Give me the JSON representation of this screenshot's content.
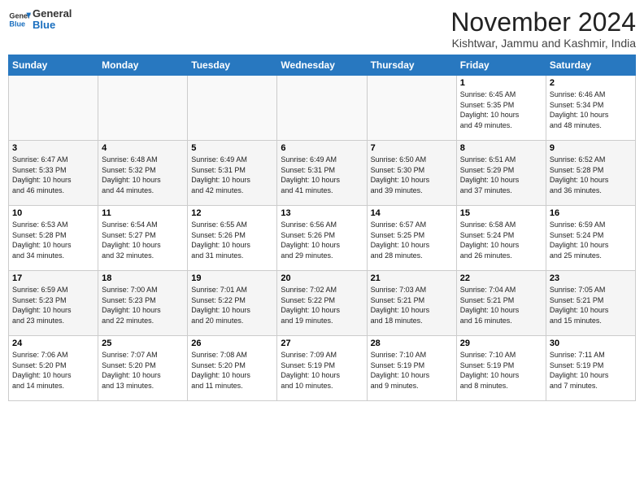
{
  "header": {
    "logo_line1": "General",
    "logo_line2": "Blue",
    "month_title": "November 2024",
    "location": "Kishtwar, Jammu and Kashmir, India"
  },
  "days_of_week": [
    "Sunday",
    "Monday",
    "Tuesday",
    "Wednesday",
    "Thursday",
    "Friday",
    "Saturday"
  ],
  "weeks": [
    [
      {
        "day": "",
        "info": ""
      },
      {
        "day": "",
        "info": ""
      },
      {
        "day": "",
        "info": ""
      },
      {
        "day": "",
        "info": ""
      },
      {
        "day": "",
        "info": ""
      },
      {
        "day": "1",
        "info": "Sunrise: 6:45 AM\nSunset: 5:35 PM\nDaylight: 10 hours\nand 49 minutes."
      },
      {
        "day": "2",
        "info": "Sunrise: 6:46 AM\nSunset: 5:34 PM\nDaylight: 10 hours\nand 48 minutes."
      }
    ],
    [
      {
        "day": "3",
        "info": "Sunrise: 6:47 AM\nSunset: 5:33 PM\nDaylight: 10 hours\nand 46 minutes."
      },
      {
        "day": "4",
        "info": "Sunrise: 6:48 AM\nSunset: 5:32 PM\nDaylight: 10 hours\nand 44 minutes."
      },
      {
        "day": "5",
        "info": "Sunrise: 6:49 AM\nSunset: 5:31 PM\nDaylight: 10 hours\nand 42 minutes."
      },
      {
        "day": "6",
        "info": "Sunrise: 6:49 AM\nSunset: 5:31 PM\nDaylight: 10 hours\nand 41 minutes."
      },
      {
        "day": "7",
        "info": "Sunrise: 6:50 AM\nSunset: 5:30 PM\nDaylight: 10 hours\nand 39 minutes."
      },
      {
        "day": "8",
        "info": "Sunrise: 6:51 AM\nSunset: 5:29 PM\nDaylight: 10 hours\nand 37 minutes."
      },
      {
        "day": "9",
        "info": "Sunrise: 6:52 AM\nSunset: 5:28 PM\nDaylight: 10 hours\nand 36 minutes."
      }
    ],
    [
      {
        "day": "10",
        "info": "Sunrise: 6:53 AM\nSunset: 5:28 PM\nDaylight: 10 hours\nand 34 minutes."
      },
      {
        "day": "11",
        "info": "Sunrise: 6:54 AM\nSunset: 5:27 PM\nDaylight: 10 hours\nand 32 minutes."
      },
      {
        "day": "12",
        "info": "Sunrise: 6:55 AM\nSunset: 5:26 PM\nDaylight: 10 hours\nand 31 minutes."
      },
      {
        "day": "13",
        "info": "Sunrise: 6:56 AM\nSunset: 5:26 PM\nDaylight: 10 hours\nand 29 minutes."
      },
      {
        "day": "14",
        "info": "Sunrise: 6:57 AM\nSunset: 5:25 PM\nDaylight: 10 hours\nand 28 minutes."
      },
      {
        "day": "15",
        "info": "Sunrise: 6:58 AM\nSunset: 5:24 PM\nDaylight: 10 hours\nand 26 minutes."
      },
      {
        "day": "16",
        "info": "Sunrise: 6:59 AM\nSunset: 5:24 PM\nDaylight: 10 hours\nand 25 minutes."
      }
    ],
    [
      {
        "day": "17",
        "info": "Sunrise: 6:59 AM\nSunset: 5:23 PM\nDaylight: 10 hours\nand 23 minutes."
      },
      {
        "day": "18",
        "info": "Sunrise: 7:00 AM\nSunset: 5:23 PM\nDaylight: 10 hours\nand 22 minutes."
      },
      {
        "day": "19",
        "info": "Sunrise: 7:01 AM\nSunset: 5:22 PM\nDaylight: 10 hours\nand 20 minutes."
      },
      {
        "day": "20",
        "info": "Sunrise: 7:02 AM\nSunset: 5:22 PM\nDaylight: 10 hours\nand 19 minutes."
      },
      {
        "day": "21",
        "info": "Sunrise: 7:03 AM\nSunset: 5:21 PM\nDaylight: 10 hours\nand 18 minutes."
      },
      {
        "day": "22",
        "info": "Sunrise: 7:04 AM\nSunset: 5:21 PM\nDaylight: 10 hours\nand 16 minutes."
      },
      {
        "day": "23",
        "info": "Sunrise: 7:05 AM\nSunset: 5:21 PM\nDaylight: 10 hours\nand 15 minutes."
      }
    ],
    [
      {
        "day": "24",
        "info": "Sunrise: 7:06 AM\nSunset: 5:20 PM\nDaylight: 10 hours\nand 14 minutes."
      },
      {
        "day": "25",
        "info": "Sunrise: 7:07 AM\nSunset: 5:20 PM\nDaylight: 10 hours\nand 13 minutes."
      },
      {
        "day": "26",
        "info": "Sunrise: 7:08 AM\nSunset: 5:20 PM\nDaylight: 10 hours\nand 11 minutes."
      },
      {
        "day": "27",
        "info": "Sunrise: 7:09 AM\nSunset: 5:19 PM\nDaylight: 10 hours\nand 10 minutes."
      },
      {
        "day": "28",
        "info": "Sunrise: 7:10 AM\nSunset: 5:19 PM\nDaylight: 10 hours\nand 9 minutes."
      },
      {
        "day": "29",
        "info": "Sunrise: 7:10 AM\nSunset: 5:19 PM\nDaylight: 10 hours\nand 8 minutes."
      },
      {
        "day": "30",
        "info": "Sunrise: 7:11 AM\nSunset: 5:19 PM\nDaylight: 10 hours\nand 7 minutes."
      }
    ]
  ]
}
